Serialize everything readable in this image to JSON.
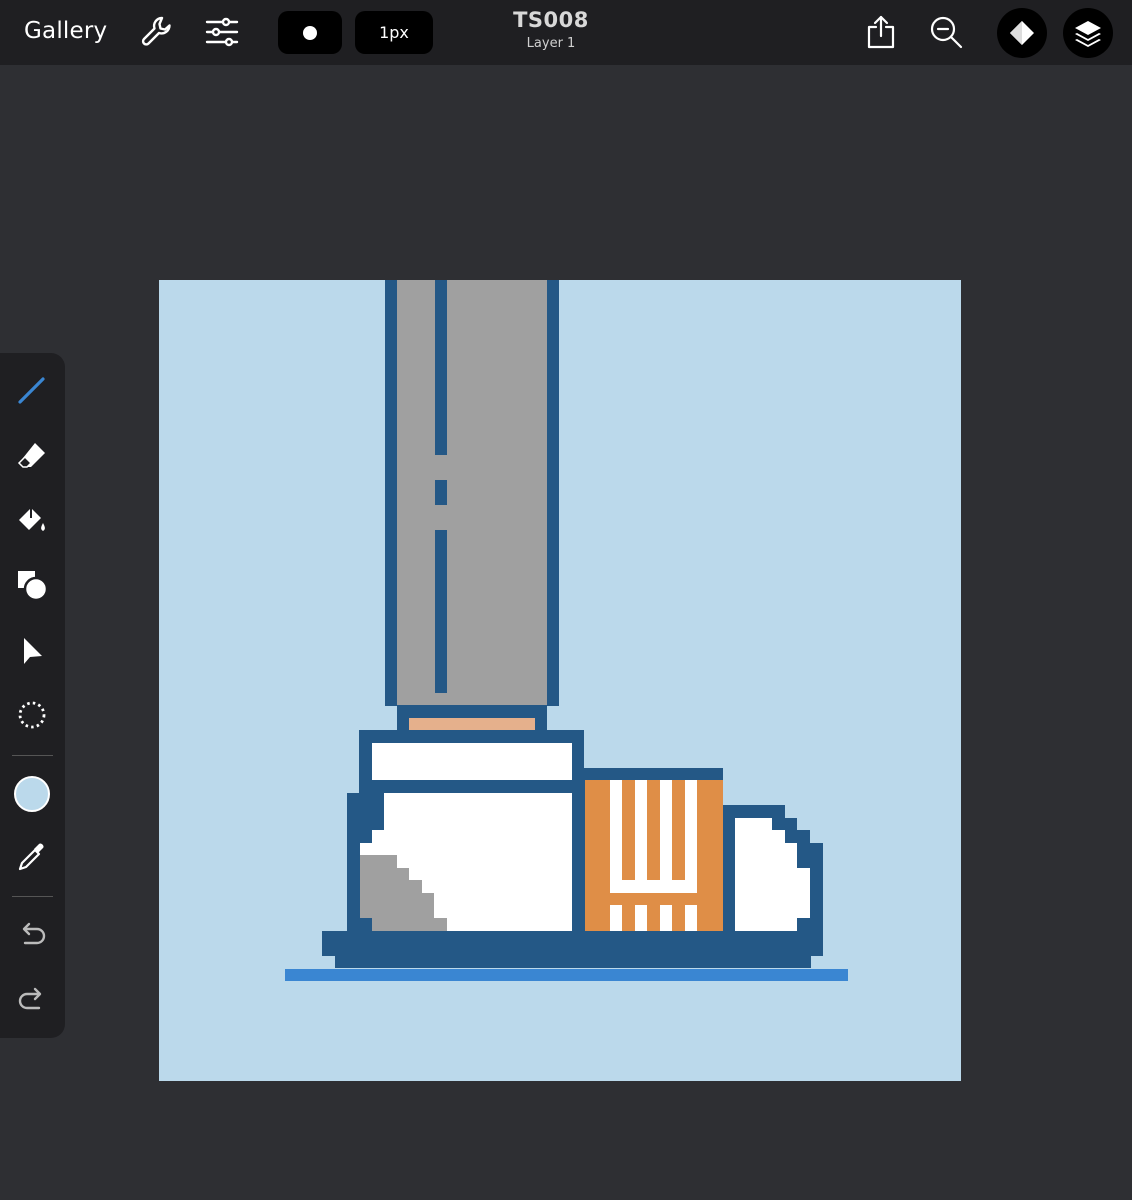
{
  "header": {
    "gallery_label": "Gallery",
    "brush_size_label": "1px",
    "document_title": "TS008",
    "layer_label": "Layer 1"
  },
  "icons": {
    "actions": "wrench-icon",
    "adjustments": "sliders-icon",
    "share": "share-icon",
    "zoom": "zoom-out-icon",
    "layers": "layers-icon"
  },
  "toolbar": {
    "active_color": "#bbd9eb",
    "tools": [
      "pencil-icon",
      "eraser-icon",
      "fill-icon",
      "shapes-icon",
      "select-icon",
      "lasso-icon",
      "eyedropper-icon",
      "undo-icon",
      "redo-icon"
    ]
  },
  "colors": {
    "canvas_bg": "#bbd9eb",
    "outline": "#245886",
    "sock": "#a0a0a0",
    "skin": "#e5b08c",
    "white": "#ffffff",
    "orange": "#df8e47",
    "ground": "#3a86d2",
    "ui_accent": "#3a86d2"
  }
}
